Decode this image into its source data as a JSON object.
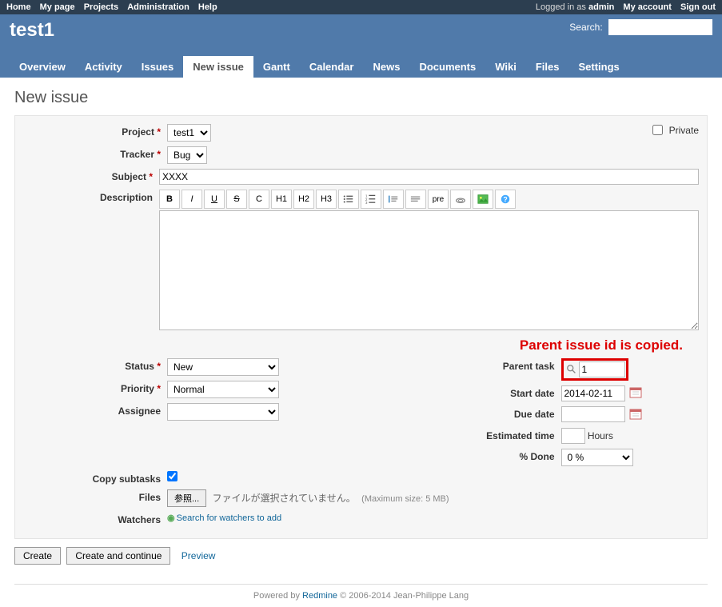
{
  "top_menu": {
    "left": [
      "Home",
      "My page",
      "Projects",
      "Administration",
      "Help"
    ],
    "logged_prefix": "Logged in as ",
    "logged_user": "admin",
    "right": [
      "My account",
      "Sign out"
    ]
  },
  "header": {
    "project_title": "test1",
    "search_label": "Search:"
  },
  "main_menu": [
    "Overview",
    "Activity",
    "Issues",
    "New issue",
    "Gantt",
    "Calendar",
    "News",
    "Documents",
    "Wiki",
    "Files",
    "Settings"
  ],
  "main_menu_selected": "New issue",
  "page_title": "New issue",
  "private_label": "Private",
  "labels": {
    "project": "Project",
    "tracker": "Tracker",
    "subject": "Subject",
    "description": "Description",
    "status": "Status",
    "priority": "Priority",
    "assignee": "Assignee",
    "parent_task": "Parent task",
    "start_date": "Start date",
    "due_date": "Due date",
    "estimated_time": "Estimated time",
    "percent_done": "% Done",
    "copy_subtasks": "Copy subtasks",
    "files": "Files",
    "watchers": "Watchers"
  },
  "values": {
    "project": "test1",
    "tracker": "Bug",
    "subject": "XXXX",
    "status": "New",
    "priority": "Normal",
    "assignee": "",
    "parent_task": "1",
    "start_date": "2014-02-11",
    "due_date": "",
    "estimated_time": "",
    "percent_done": "0 %",
    "hours_suffix": "Hours",
    "copy_subtasks": true
  },
  "annotation": "Parent issue id is copied.",
  "files": {
    "browse_button": "参照...",
    "no_file": "ファイルが選択されていません。",
    "hint": "(Maximum size: 5 MB)"
  },
  "watchers_link": "Search for watchers to add",
  "buttons": {
    "create": "Create",
    "create_continue": "Create and continue",
    "preview": "Preview"
  },
  "footer": {
    "prefix": "Powered by ",
    "link": "Redmine",
    "suffix": " © 2006-2014 Jean-Philippe Lang"
  },
  "toolbar_buttons": [
    "B",
    "I",
    "U",
    "S",
    "C",
    "H1",
    "H2",
    "H3",
    "ul",
    "ol",
    "bq",
    "unbq",
    "pre",
    "link",
    "img",
    "help"
  ]
}
